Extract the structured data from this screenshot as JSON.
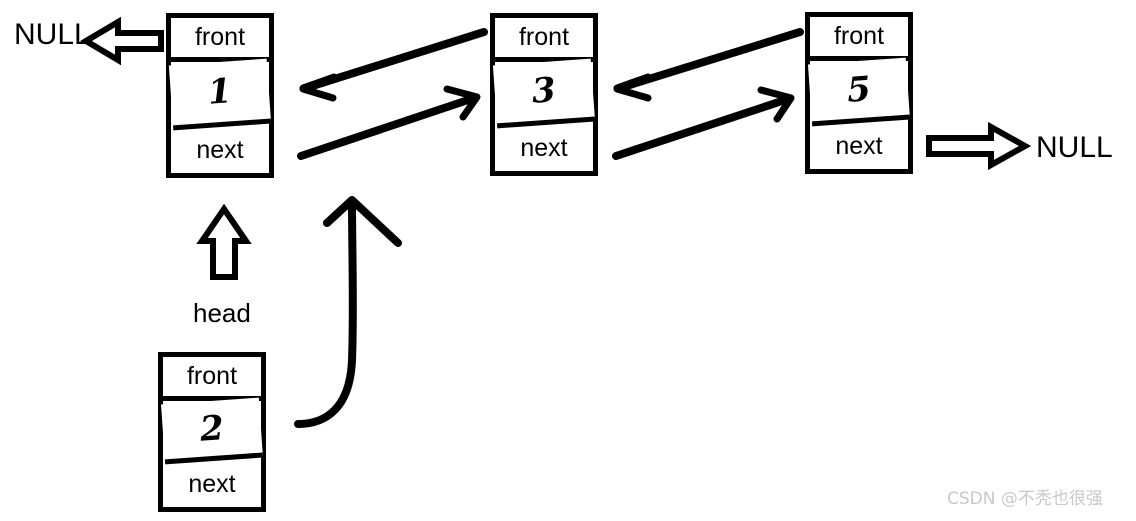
{
  "diagram": {
    "title": "singly-linked-list-insertion",
    "nodes": [
      {
        "id": "node-1",
        "front_label": "front",
        "value": "1",
        "next_label": "next"
      },
      {
        "id": "node-2",
        "front_label": "front",
        "value": "3",
        "next_label": "next"
      },
      {
        "id": "node-3",
        "front_label": "front",
        "value": "5",
        "next_label": "next"
      },
      {
        "id": "node-new",
        "front_label": "front",
        "value": "2",
        "next_label": "next"
      }
    ],
    "labels": {
      "null_left": "NULL",
      "null_right": "NULL",
      "head": "head"
    },
    "watermark": "CSDN @不秃也很强",
    "colors": {
      "ink": "#000000",
      "background": "#ffffff",
      "watermark": "#c9c9c9"
    }
  }
}
